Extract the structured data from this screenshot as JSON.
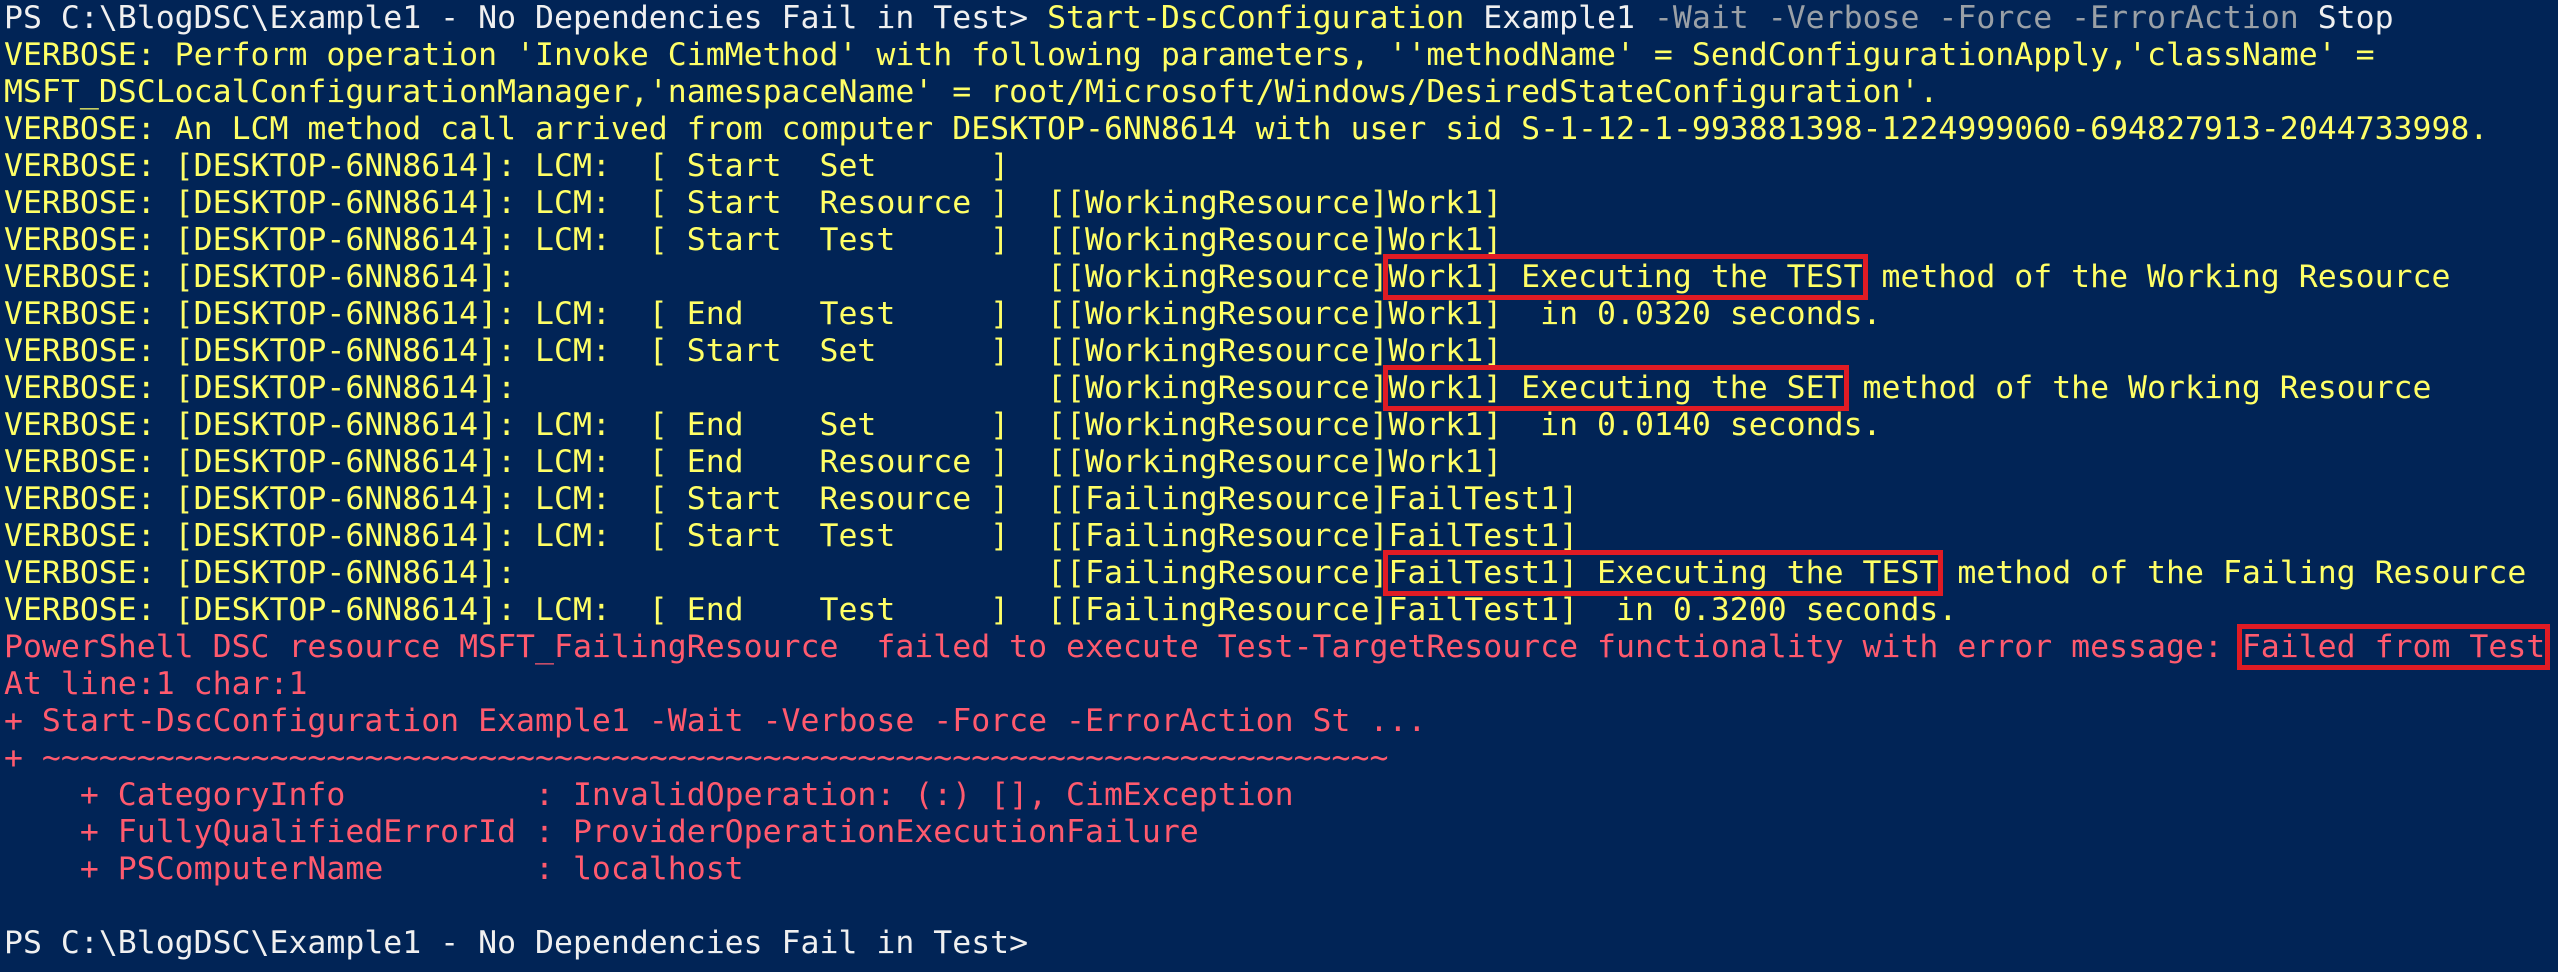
{
  "window": {
    "background": "#012456",
    "verbose_color": "#ffff66",
    "error_color": "#ff5a6e",
    "highlight_color": "#e01b24"
  },
  "prompt": "PS C:\\BlogDSC\\Example1 - No Dependencies Fail in Test> ",
  "command": {
    "name": "Start-DscConfiguration",
    "arg": " Example1 ",
    "params": "-Wait -Verbose -Force -ErrorAction",
    "value": " Stop"
  },
  "lines": [
    {
      "text": "VERBOSE: Perform operation 'Invoke CimMethod' with following parameters, ''methodName' = SendConfigurationApply,'className' ="
    },
    {
      "text": "MSFT_DSCLocalConfigurationManager,'namespaceName' = root/Microsoft/Windows/DesiredStateConfiguration'."
    },
    {
      "text": "VERBOSE: An LCM method call arrived from computer DESKTOP-6NN8614 with user sid S-1-12-1-993881398-1224999060-694827913-2044733998."
    },
    {
      "text": "VERBOSE: [DESKTOP-6NN8614]: LCM:  [ Start  Set      ]"
    },
    {
      "text": "VERBOSE: [DESKTOP-6NN8614]: LCM:  [ Start  Resource ]  [[WorkingResource]Work1]"
    },
    {
      "text": "VERBOSE: [DESKTOP-6NN8614]: LCM:  [ Start  Test     ]  [[WorkingResource]Work1]"
    },
    {
      "pre": "VERBOSE: [DESKTOP-6NN8614]:                            [[WorkingResource]",
      "hl": "Work1] Executing the TEST",
      "post": " method of the Working Resource"
    },
    {
      "text": "VERBOSE: [DESKTOP-6NN8614]: LCM:  [ End    Test     ]  [[WorkingResource]Work1]  in 0.0320 seconds."
    },
    {
      "text": "VERBOSE: [DESKTOP-6NN8614]: LCM:  [ Start  Set      ]  [[WorkingResource]Work1]"
    },
    {
      "pre": "VERBOSE: [DESKTOP-6NN8614]:                            [[WorkingResource]",
      "hl": "Work1] Executing the SET",
      "post": " method of the Working Resource"
    },
    {
      "text": "VERBOSE: [DESKTOP-6NN8614]: LCM:  [ End    Set      ]  [[WorkingResource]Work1]  in 0.0140 seconds."
    },
    {
      "text": "VERBOSE: [DESKTOP-6NN8614]: LCM:  [ End    Resource ]  [[WorkingResource]Work1]"
    },
    {
      "text": "VERBOSE: [DESKTOP-6NN8614]: LCM:  [ Start  Resource ]  [[FailingResource]FailTest1]"
    },
    {
      "text": "VERBOSE: [DESKTOP-6NN8614]: LCM:  [ Start  Test     ]  [[FailingResource]FailTest1]"
    },
    {
      "pre": "VERBOSE: [DESKTOP-6NN8614]:                            [[FailingResource]",
      "hl": "FailTest1] Executing the TEST",
      "post": " method of the Failing Resource"
    },
    {
      "text": "VERBOSE: [DESKTOP-6NN8614]: LCM:  [ End    Test     ]  [[FailingResource]FailTest1]  in 0.3200 seconds."
    }
  ],
  "error": {
    "pre": "PowerShell DSC resource MSFT_FailingResource  failed to execute Test-TargetResource functionality with error message: ",
    "hl": "Failed from Test",
    "lines": [
      "At line:1 char:1",
      "+ Start-DscConfiguration Example1 -Wait -Verbose -Force -ErrorAction St ...",
      "+ ~~~~~~~~~~~~~~~~~~~~~~~~~~~~~~~~~~~~~~~~~~~~~~~~~~~~~~~~~~~~~~~~~~~~~~~",
      "    + CategoryInfo          : InvalidOperation: (:) [], CimException",
      "    + FullyQualifiedErrorId : ProviderOperationExecutionFailure",
      "    + PSComputerName        : localhost"
    ]
  },
  "final_prompt": "PS C:\\BlogDSC\\Example1 - No Dependencies Fail in Test>"
}
